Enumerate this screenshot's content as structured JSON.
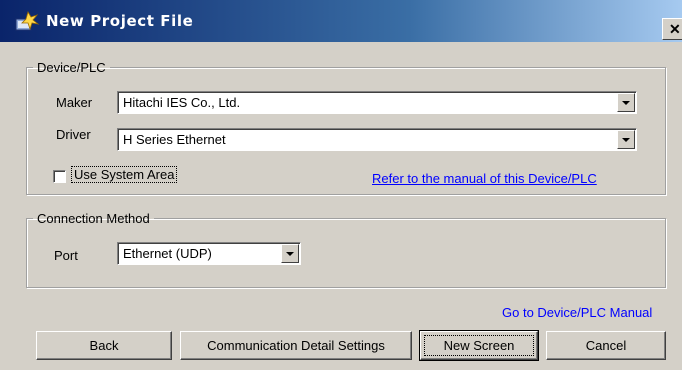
{
  "window": {
    "title": "New Project File",
    "icon": "new-project-icon",
    "close_glyph": "✕"
  },
  "device_plc": {
    "group_label": "Device/PLC",
    "maker_label": "Maker",
    "maker_value": "Hitachi IES Co., Ltd.",
    "driver_label": "Driver",
    "driver_value": "H Series Ethernet",
    "use_system_area_label": "Use System Area",
    "use_system_area_checked": false,
    "manual_link": "Refer to the manual of this Device/PLC"
  },
  "connection": {
    "group_label": "Connection Method",
    "port_label": "Port",
    "port_value": "Ethernet (UDP)"
  },
  "footer": {
    "manual_link": "Go to Device/PLC Manual",
    "back_label": "Back",
    "comm_settings_label": "Communication Detail Settings",
    "new_screen_label": "New Screen",
    "cancel_label": "Cancel"
  },
  "colors": {
    "link": "#0000ff",
    "dialog_bg": "#d4d0c8",
    "title_start": "#0a246a"
  }
}
